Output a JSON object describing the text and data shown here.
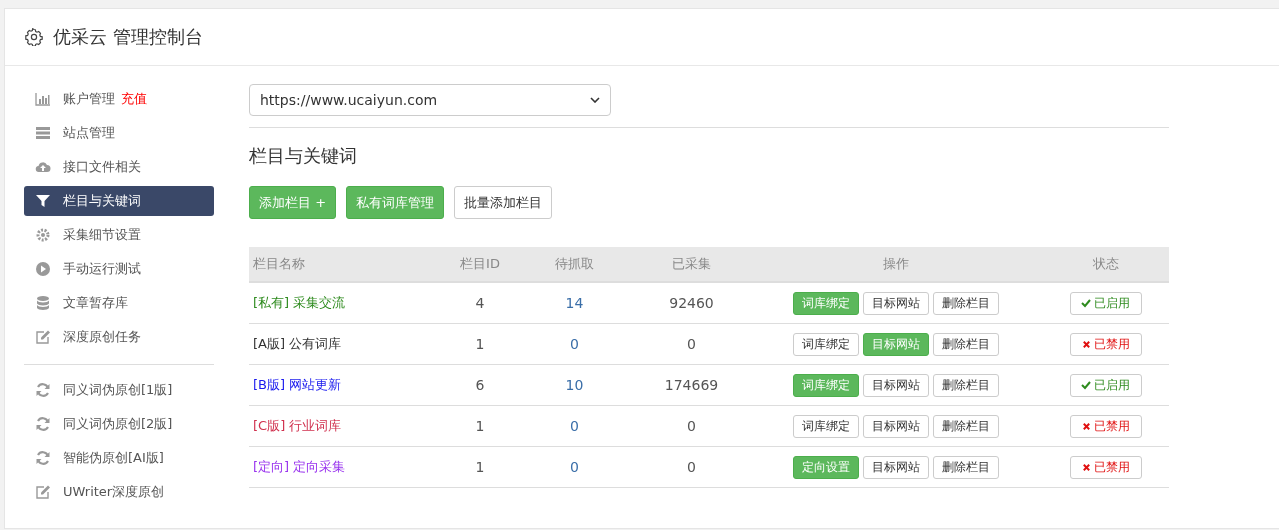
{
  "header": {
    "title": "优采云 管理控制台"
  },
  "sidebar": {
    "items": [
      {
        "kind": "link",
        "label": "账户管理",
        "badge": "充值",
        "selected": false
      },
      {
        "kind": "link",
        "label": "站点管理",
        "selected": false
      },
      {
        "kind": "link",
        "label": "接口文件相关",
        "selected": false
      },
      {
        "kind": "link",
        "label": "栏目与关键词",
        "selected": true
      },
      {
        "kind": "link",
        "label": "采集细节设置",
        "selected": false
      },
      {
        "kind": "link",
        "label": "手动运行测试",
        "selected": false
      },
      {
        "kind": "link",
        "label": "文章暂存库",
        "selected": false
      },
      {
        "kind": "link",
        "label": "深度原创任务",
        "selected": false
      },
      {
        "kind": "divider"
      },
      {
        "kind": "link",
        "label": "同义词伪原创[1版]",
        "selected": false
      },
      {
        "kind": "link",
        "label": "同义词伪原创[2版]",
        "selected": false
      },
      {
        "kind": "link",
        "label": "智能伪原创[AI版]",
        "selected": false
      },
      {
        "kind": "link",
        "label": "UWriter深度原创",
        "selected": false
      }
    ]
  },
  "site_select": {
    "value": "https://www.ucaiyun.com"
  },
  "section_title": "栏目与关键词",
  "toolbar": [
    {
      "label": "添加栏目 +",
      "primary": true
    },
    {
      "label": "私有词库管理",
      "primary": true
    },
    {
      "label": "批量添加栏目",
      "primary": false
    }
  ],
  "table": {
    "columns": [
      "栏目名称",
      "栏目ID",
      "待抓取",
      "已采集",
      "操作",
      "状态"
    ],
    "rows": [
      {
        "name": "[私有] 采集交流",
        "color": "#2e8b1e",
        "id": "4",
        "pending": "14",
        "collected": "92460",
        "actions": [
          {
            "label": "词库绑定",
            "active": true
          },
          {
            "label": "目标网站",
            "active": false
          },
          {
            "label": "删除栏目",
            "active": false
          }
        ],
        "enabled": true,
        "status": "已启用"
      },
      {
        "name": "[A版] 公有词库",
        "color": "#333333",
        "id": "1",
        "pending": "0",
        "collected": "0",
        "actions": [
          {
            "label": "词库绑定",
            "active": false
          },
          {
            "label": "目标网站",
            "active": true
          },
          {
            "label": "删除栏目",
            "active": false
          }
        ],
        "enabled": false,
        "status": "已禁用"
      },
      {
        "name": "[B版] 网站更新",
        "color": "#1a1aee",
        "id": "6",
        "pending": "10",
        "collected": "174669",
        "actions": [
          {
            "label": "词库绑定",
            "active": true
          },
          {
            "label": "目标网站",
            "active": false
          },
          {
            "label": "删除栏目",
            "active": false
          }
        ],
        "enabled": true,
        "status": "已启用"
      },
      {
        "name": "[C版] 行业词库",
        "color": "#d0304e",
        "id": "1",
        "pending": "0",
        "collected": "0",
        "actions": [
          {
            "label": "词库绑定",
            "active": false
          },
          {
            "label": "目标网站",
            "active": false
          },
          {
            "label": "删除栏目",
            "active": false
          }
        ],
        "enabled": false,
        "status": "已禁用"
      },
      {
        "name": "[定向] 定向采集",
        "color": "#9933ee",
        "id": "1",
        "pending": "0",
        "collected": "0",
        "actions": [
          {
            "label": "定向设置",
            "active": true
          },
          {
            "label": "目标网站",
            "active": false
          },
          {
            "label": "删除栏目",
            "active": false
          }
        ],
        "enabled": false,
        "status": "已禁用"
      }
    ]
  }
}
